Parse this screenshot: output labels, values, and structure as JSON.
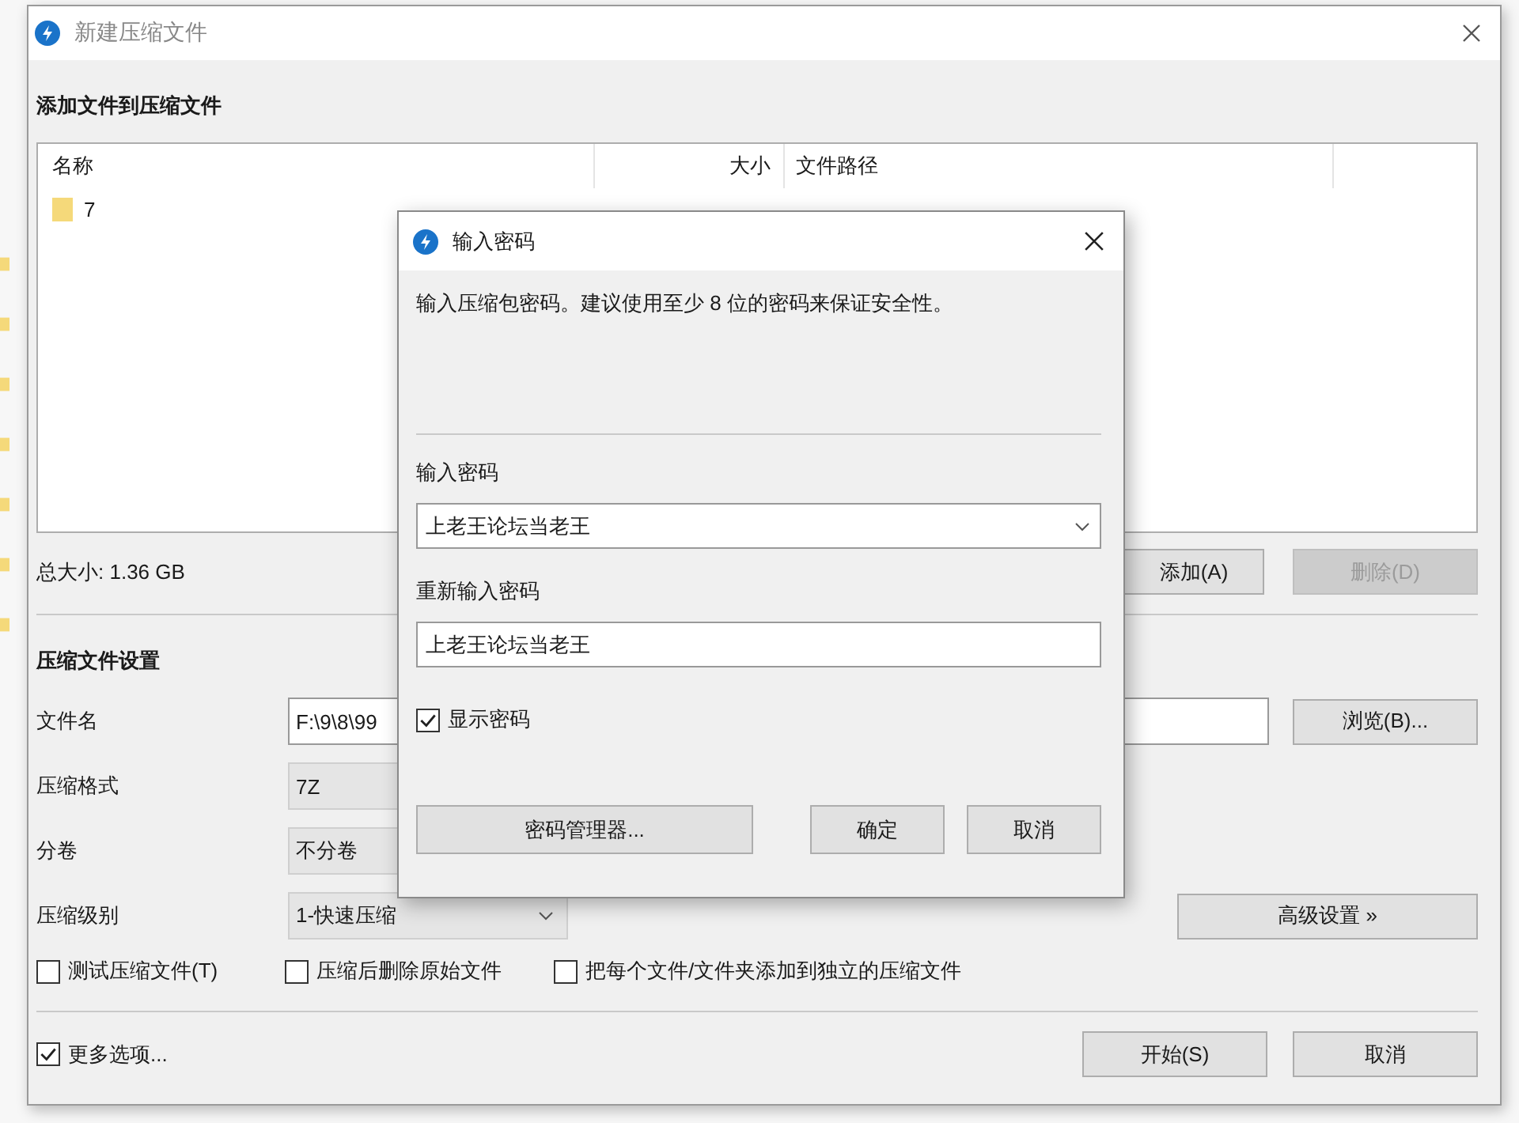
{
  "window": {
    "title": "新建压缩文件"
  },
  "files": {
    "heading": "添加文件到压缩文件",
    "columns": [
      "名称",
      "大小",
      "文件路径"
    ],
    "rows": [
      {
        "name": "7"
      }
    ],
    "total": "总大小: 1.36 GB",
    "buttons": [
      {
        "label": "添加(A)",
        "disabled": false
      },
      {
        "label": "删除(D)",
        "disabled": true
      }
    ]
  },
  "settings": {
    "heading": "压缩文件设置",
    "fields": [
      {
        "kind": "text",
        "label": "文件名",
        "value": "F:\\9\\8\\99"
      },
      {
        "kind": "combo",
        "label": "压缩格式",
        "value": "7Z"
      },
      {
        "kind": "combo",
        "label": "分卷",
        "value": "不分卷"
      },
      {
        "kind": "combo",
        "label": "压缩级别",
        "value": "1-快速压缩"
      }
    ],
    "browse": "浏览(B)...",
    "advanced": "高级设置 »",
    "options": [
      {
        "label": "测试压缩文件(T)",
        "checked": false
      },
      {
        "label": "压缩后删除原始文件",
        "checked": false
      },
      {
        "label": "把每个文件/文件夹添加到独立的压缩文件",
        "checked": false
      }
    ]
  },
  "more_options": {
    "label": "更多选项...",
    "checked": true
  },
  "footer_buttons": [
    "开始(S)",
    "取消"
  ],
  "dialog": {
    "title": "输入密码",
    "message": "输入压缩包密码。建议使用至少 8 位的密码来保证安全性。",
    "password_label": "输入密码",
    "password": "上老王论坛当老王",
    "confirm_label": "重新输入密码",
    "confirm": "上老王论坛当老王",
    "show_password": {
      "label": "显示密码",
      "checked": true
    },
    "manager": "密码管理器...",
    "buttons": [
      "确定",
      "取消"
    ]
  }
}
